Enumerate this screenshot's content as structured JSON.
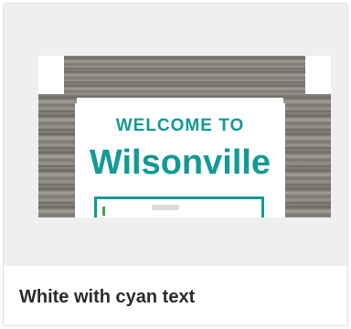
{
  "option": {
    "label": "White with cyan text"
  },
  "sign": {
    "line1": "WELCOME TO",
    "line2": "Wilsonville",
    "accent_color": "#129a96",
    "background_color": "#ffffff"
  }
}
